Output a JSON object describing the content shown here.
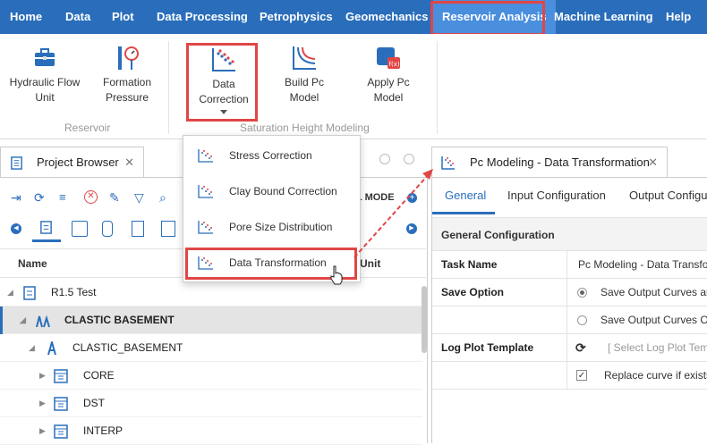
{
  "menubar": {
    "items": [
      "Home",
      "Data",
      "Plot",
      "Data Processing",
      "Petrophysics",
      "Geomechanics",
      "Reservoir Analysis",
      "Machine Learning",
      "Help"
    ],
    "active": "Reservoir Analysis"
  },
  "ribbon": {
    "reservoir_group": {
      "label": "Reservoir",
      "buttons": [
        "Hydraulic Flow Unit",
        "Formation Pressure"
      ]
    },
    "saturation_group": {
      "label": "Saturation Height Modeling",
      "buttons": [
        "Data Correction",
        "Build Pc Model",
        "Apply Pc Model"
      ]
    }
  },
  "dropdown": {
    "items": [
      "Stress Correction",
      "Clay Bound Correction",
      "Pore Size Distribution",
      "Data Transformation"
    ],
    "highlighted": "Data Transformation"
  },
  "project_browser": {
    "tab_label": "Project Browser",
    "column_name": "Name",
    "column_unit": "Unit",
    "mode_label": "L MODE",
    "tree": [
      {
        "label": "R1.5 Test",
        "icon": "project-icon"
      },
      {
        "label": "CLASTIC BASEMENT",
        "icon": "field-icon",
        "selected": true
      },
      {
        "label": "CLASTIC_BASEMENT",
        "icon": "well-icon"
      },
      {
        "label": "CORE",
        "icon": "dataset-icon"
      },
      {
        "label": "DST",
        "icon": "dataset-icon"
      },
      {
        "label": "INTERP",
        "icon": "dataset-icon"
      }
    ]
  },
  "pc_modeling": {
    "tab_label": "Pc Modeling - Data Transformation",
    "tabs": [
      "General",
      "Input Configuration",
      "Output Configu"
    ],
    "active_tab": "General",
    "section_title": "General Configuration",
    "task_name_label": "Task Name",
    "task_name_value": "Pc Modeling - Data Transfor",
    "save_option_label": "Save Option",
    "save_options": [
      "Save Output Curves an",
      "Save Output Curves Or"
    ],
    "log_plot_label": "Log Plot Template",
    "log_plot_placeholder": "[ Select Log Plot Tem",
    "replace_curve_label": "Replace curve if exists"
  },
  "colors": {
    "menubar_bg": "#2a6ebb",
    "highlight": "#e04646",
    "accent": "#2a6ebb"
  }
}
